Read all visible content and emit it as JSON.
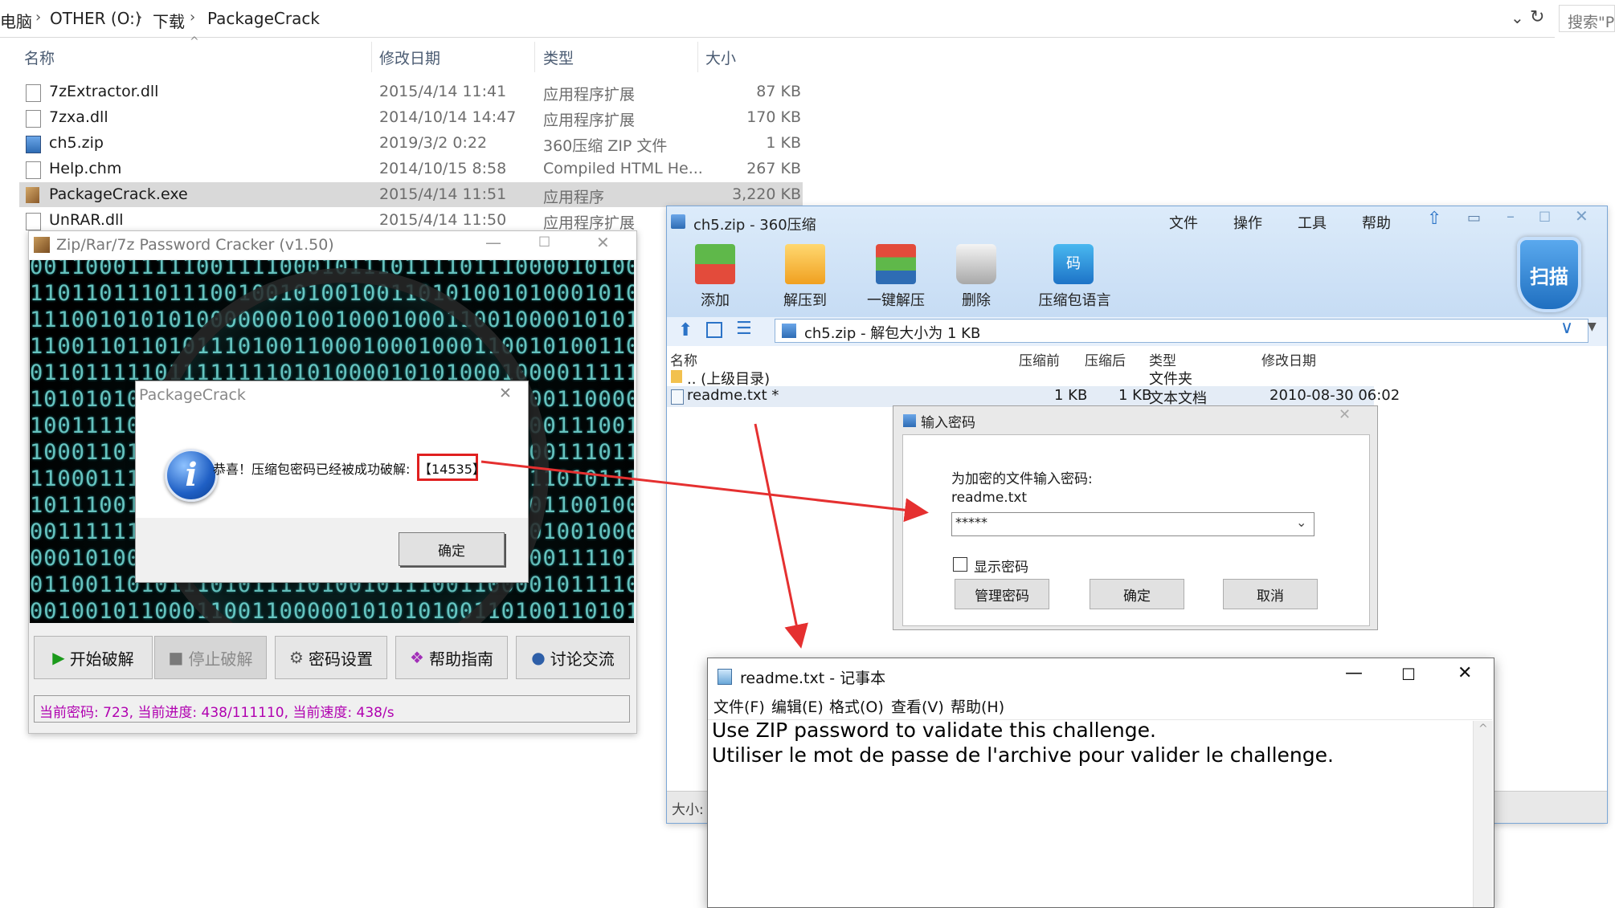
{
  "explorer": {
    "breadcrumb": [
      "电脑",
      "OTHER (O:)",
      "下载",
      "PackageCrack"
    ],
    "search_placeholder": "搜索\"Pa",
    "columns": {
      "name": "名称",
      "modified": "修改日期",
      "type": "类型",
      "size": "大小"
    },
    "files": [
      {
        "name": "7zExtractor.dll",
        "modified": "2015/4/14 11:41",
        "type": "应用程序扩展",
        "size": "87 KB",
        "icon": "dll-icon",
        "selected": false
      },
      {
        "name": "7zxa.dll",
        "modified": "2014/10/14 14:47",
        "type": "应用程序扩展",
        "size": "170 KB",
        "icon": "dll-icon",
        "selected": false
      },
      {
        "name": "ch5.zip",
        "modified": "2019/3/2 0:22",
        "type": "360压缩 ZIP 文件",
        "size": "1 KB",
        "icon": "zip-icon",
        "selected": false
      },
      {
        "name": "Help.chm",
        "modified": "2014/10/15 8:58",
        "type": "Compiled HTML He...",
        "size": "267 KB",
        "icon": "chm-icon",
        "selected": false
      },
      {
        "name": "PackageCrack.exe",
        "modified": "2015/4/14 11:51",
        "type": "应用程序",
        "size": "3,220 KB",
        "icon": "exe-box-icon",
        "selected": true
      },
      {
        "name": "UnRAR.dll",
        "modified": "2015/4/14 11:50",
        "type": "应用程序扩展",
        "size": "",
        "icon": "dll-icon",
        "selected": false
      }
    ]
  },
  "cracker": {
    "title": "Zip/Rar/7z Password Cracker (v1.50)",
    "buttons": [
      "开始破解",
      "停止破解",
      "密码设置",
      "帮助指南",
      "讨论交流"
    ],
    "status": "当前密码: 723, 当前进度: 438/111110, 当前速度: 438/s"
  },
  "msgbox": {
    "title": "PackageCrack",
    "message": "恭喜！压缩包密码已经被成功破解:",
    "password": "【14535】",
    "ok": "确定"
  },
  "zip360": {
    "title": "ch5.zip - 360压缩",
    "menu": [
      "文件",
      "操作",
      "工具",
      "帮助"
    ],
    "tools": [
      "添加",
      "解压到",
      "一键解压",
      "删除",
      "压缩包语言"
    ],
    "scan": "扫描",
    "path": "ch5.zip - 解包大小为 1 KB",
    "columns": {
      "name": "名称",
      "before": "压缩前",
      "after": "压缩后",
      "type": "类型",
      "modified": "修改日期"
    },
    "rows": [
      {
        "name": ".. (上级目录)",
        "before": "",
        "after": "",
        "type": "文件夹",
        "modified": ""
      },
      {
        "name": "readme.txt *",
        "before": "1 KB",
        "after": "1 KB",
        "type": "文本文档",
        "modified": "2010-08-30 06:02"
      }
    ],
    "statusbar": "大小:"
  },
  "pwdialog": {
    "title": "输入密码",
    "prompt": "为加密的文件输入密码:",
    "filename": "readme.txt",
    "value": "*****",
    "show_password": "显示密码",
    "manage": "管理密码",
    "ok": "确定",
    "cancel": "取消"
  },
  "notepad": {
    "title": "readme.txt - 记事本",
    "menu": [
      "文件(F)",
      "编辑(E)",
      "格式(O)",
      "查看(V)",
      "帮助(H)"
    ],
    "content": "Use ZIP password to validate this challenge.\nUtiliser le mot de passe de l'archive pour valider le challenge."
  },
  "colors": {
    "highlight_red": "#e02020",
    "status_magenta": "#b000b0",
    "arrow_red": "#e53030"
  }
}
